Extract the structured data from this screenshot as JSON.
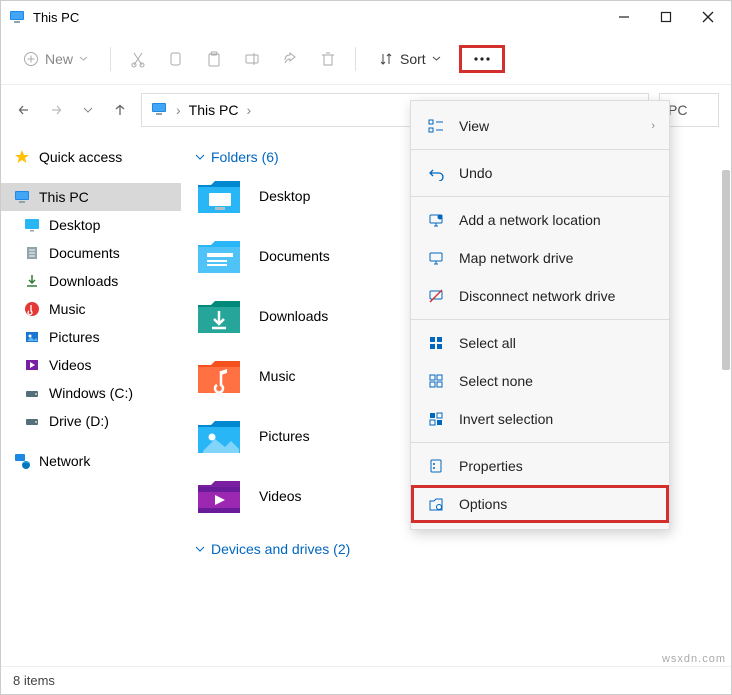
{
  "titlebar": {
    "title": "This PC"
  },
  "toolbar": {
    "new_label": "New",
    "sort_label": "Sort"
  },
  "address": {
    "path": "This PC"
  },
  "search": {
    "hint": "PC"
  },
  "sidebar": {
    "quick_access": "Quick access",
    "this_pc": "This PC",
    "items": [
      {
        "label": "Desktop"
      },
      {
        "label": "Documents"
      },
      {
        "label": "Downloads"
      },
      {
        "label": "Music"
      },
      {
        "label": "Pictures"
      },
      {
        "label": "Videos"
      },
      {
        "label": "Windows (C:)"
      },
      {
        "label": "Drive (D:)"
      }
    ],
    "network": "Network"
  },
  "content": {
    "folders_header": "Folders (6)",
    "folders": [
      {
        "label": "Desktop"
      },
      {
        "label": "Documents"
      },
      {
        "label": "Downloads"
      },
      {
        "label": "Music"
      },
      {
        "label": "Pictures"
      },
      {
        "label": "Videos"
      }
    ],
    "devices_header": "Devices and drives (2)"
  },
  "menu": {
    "view": "View",
    "undo": "Undo",
    "add_network_location": "Add a network location",
    "map_network_drive": "Map network drive",
    "disconnect_network_drive": "Disconnect network drive",
    "select_all": "Select all",
    "select_none": "Select none",
    "invert_selection": "Invert selection",
    "properties": "Properties",
    "options": "Options"
  },
  "status": {
    "count": "8 items"
  },
  "watermark": "wsxdn.com"
}
